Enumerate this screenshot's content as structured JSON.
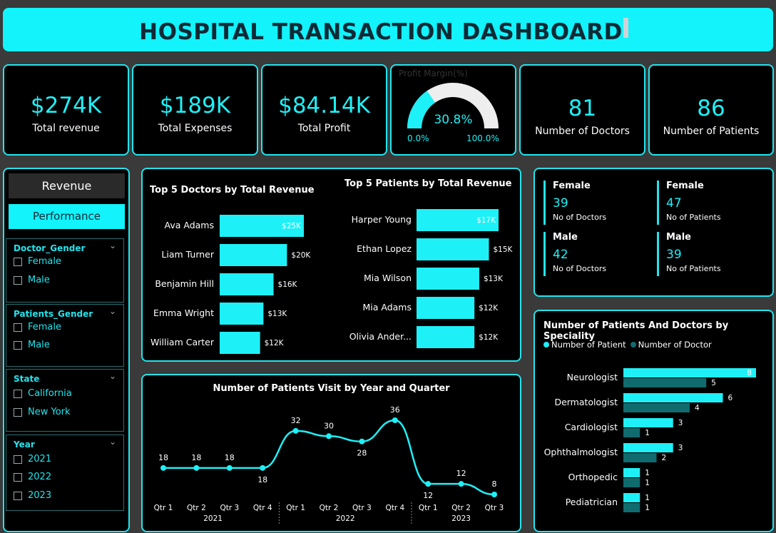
{
  "header": {
    "title": "HOSPITAL TRANSACTION DASHBOARD"
  },
  "kpis": {
    "revenue": {
      "value": "$274K",
      "label": "Total revenue"
    },
    "expenses": {
      "value": "$189K",
      "label": "Total Expenses"
    },
    "profit": {
      "value": "$84.14K",
      "label": "Total Profit"
    },
    "doctors": {
      "value": "81",
      "label": "Number of Doctors"
    },
    "patients": {
      "value": "86",
      "label": "Number of Patients"
    }
  },
  "gauge": {
    "title": "Profit Margin(%)",
    "value": "30.8%",
    "value_num": 30.8,
    "min": "0.0%",
    "max": "100.0%"
  },
  "nav": {
    "revenue_label": "Revenue",
    "performance_label": "Performance"
  },
  "slicers": {
    "doctor_gender": {
      "title": "Doctor_Gender",
      "options": [
        "Female",
        "Male"
      ]
    },
    "patients_gender": {
      "title": "Patients_Gender",
      "options": [
        "Female",
        "Male"
      ]
    },
    "state": {
      "title": "State",
      "options": [
        "California",
        "New York"
      ]
    },
    "year": {
      "title": "Year",
      "options": [
        "2021",
        "2022",
        "2023"
      ]
    }
  },
  "top_doctors": {
    "title": "Top 5 Doctors by Total Revenue",
    "items": [
      {
        "name": "Ava Adams",
        "value": 25,
        "label": "$25K"
      },
      {
        "name": "Liam Turner",
        "value": 20,
        "label": "$20K"
      },
      {
        "name": "Benjamin Hill",
        "value": 16,
        "label": "$16K"
      },
      {
        "name": "Emma Wright",
        "value": 13,
        "label": "$13K"
      },
      {
        "name": "William Carter",
        "value": 12,
        "label": "$12K"
      }
    ]
  },
  "top_patients": {
    "title": "Top 5 Patients by Total Revenue",
    "items": [
      {
        "name": "Harper Young",
        "value": 17,
        "label": "$17K"
      },
      {
        "name": "Ethan Lopez",
        "value": 15,
        "label": "$15K"
      },
      {
        "name": "Mia Wilson",
        "value": 13,
        "label": "$13K"
      },
      {
        "name": "Mia Adams",
        "value": 12,
        "label": "$12K"
      },
      {
        "name": "Olivia Ander...",
        "value": 12,
        "label": "$12K"
      }
    ]
  },
  "gender_stats": {
    "doctors_female": {
      "label": "Female",
      "value": "39",
      "sub": "No of Doctors"
    },
    "patients_female": {
      "label": "Female",
      "value": "47",
      "sub": "No of Patients"
    },
    "doctors_male": {
      "label": "Male",
      "value": "42",
      "sub": "No of Doctors"
    },
    "patients_male": {
      "label": "Male",
      "value": "39",
      "sub": "No of Patients"
    }
  },
  "visits_chart": {
    "title": "Number of Patients Visit by Year and Quarter",
    "points": [
      {
        "q": "Qtr 1",
        "year": "2021",
        "value": 18
      },
      {
        "q": "Qtr 2",
        "year": "2021",
        "value": 18
      },
      {
        "q": "Qtr 3",
        "year": "2021",
        "value": 18
      },
      {
        "q": "Qtr 4",
        "year": "2021",
        "value": 18
      },
      {
        "q": "Qtr 1",
        "year": "2022",
        "value": 32
      },
      {
        "q": "Qtr 2",
        "year": "2022",
        "value": 30
      },
      {
        "q": "Qtr 3",
        "year": "2022",
        "value": 28
      },
      {
        "q": "Qtr 4",
        "year": "2022",
        "value": 36
      },
      {
        "q": "Qtr 1",
        "year": "2023",
        "value": 12
      },
      {
        "q": "Qtr 2",
        "year": "2023",
        "value": 12
      },
      {
        "q": "Qtr 3",
        "year": "2023",
        "value": 8
      }
    ],
    "years": [
      "2021",
      "2022",
      "2023"
    ]
  },
  "speciality_chart": {
    "title": "Number of Patients And Doctors by Speciality",
    "legend": [
      "Number of Patient",
      "Number of Doctor"
    ],
    "colors": {
      "patient": "#1ef0f7",
      "doctor": "#0f6b6e"
    },
    "items": [
      {
        "name": "Neurologist",
        "patients": 8,
        "doctors": 5
      },
      {
        "name": "Dermatologist",
        "patients": 6,
        "doctors": 4
      },
      {
        "name": "Cardiologist",
        "patients": 3,
        "doctors": 1
      },
      {
        "name": "Ophthalmologist",
        "patients": 3,
        "doctors": 2
      },
      {
        "name": "Orthopedic",
        "patients": 1,
        "doctors": 1
      },
      {
        "name": "Pediatrician",
        "patients": 1,
        "doctors": 1
      }
    ]
  },
  "chart_data": [
    {
      "type": "bar",
      "title": "Top 5 Doctors by Total Revenue",
      "categories": [
        "Ava Adams",
        "Liam Turner",
        "Benjamin Hill",
        "Emma Wright",
        "William Carter"
      ],
      "values": [
        25,
        20,
        16,
        13,
        12
      ]
    },
    {
      "type": "bar",
      "title": "Top 5 Patients by Total Revenue",
      "categories": [
        "Harper Young",
        "Ethan Lopez",
        "Mia Wilson",
        "Mia Adams",
        "Olivia Ander..."
      ],
      "values": [
        17,
        15,
        13,
        12,
        12
      ]
    },
    {
      "type": "line",
      "title": "Number of Patients Visit by Year and Quarter",
      "categories": [
        "2021 Qtr 1",
        "2021 Qtr 2",
        "2021 Qtr 3",
        "2021 Qtr 4",
        "2022 Qtr 1",
        "2022 Qtr 2",
        "2022 Qtr 3",
        "2022 Qtr 4",
        "2023 Qtr 1",
        "2023 Qtr 2",
        "2023 Qtr 3"
      ],
      "values": [
        18,
        18,
        18,
        18,
        32,
        30,
        28,
        36,
        12,
        12,
        8
      ]
    },
    {
      "type": "bar",
      "title": "Number of Patients And Doctors by Speciality",
      "categories": [
        "Neurologist",
        "Dermatologist",
        "Cardiologist",
        "Ophthalmologist",
        "Orthopedic",
        "Pediatrician"
      ],
      "series": [
        {
          "name": "Number of Patient",
          "values": [
            8,
            6,
            3,
            3,
            1,
            1
          ]
        },
        {
          "name": "Number of Doctor",
          "values": [
            5,
            4,
            1,
            2,
            1,
            1
          ]
        }
      ]
    }
  ]
}
